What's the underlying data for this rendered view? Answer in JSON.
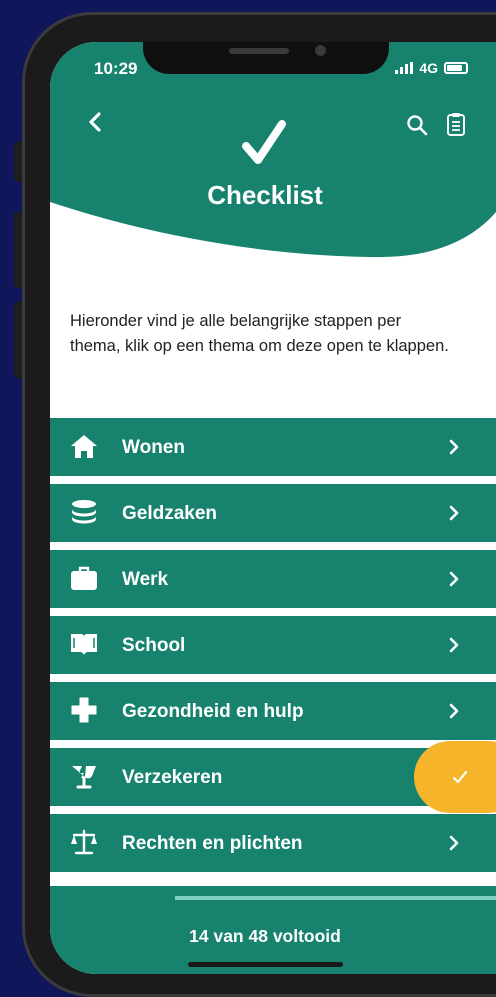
{
  "status_bar": {
    "time": "10:29",
    "network": "4G"
  },
  "header": {
    "title": "Checklist"
  },
  "intro": "Hieronder vind je alle belangrijke stappen per thema, klik op een thema om deze open te klappen.",
  "themes": [
    {
      "label": "Wonen",
      "icon": "house-icon",
      "completed": false
    },
    {
      "label": "Geldzaken",
      "icon": "coins-icon",
      "completed": false
    },
    {
      "label": "Werk",
      "icon": "briefcase-icon",
      "completed": false
    },
    {
      "label": "School",
      "icon": "book-icon",
      "completed": false
    },
    {
      "label": "Gezondheid en hulp",
      "icon": "medical-cross-icon",
      "completed": false
    },
    {
      "label": "Verzekeren",
      "icon": "umbrella-icon",
      "completed": true
    },
    {
      "label": "Rechten en plichten",
      "icon": "scales-icon",
      "completed": false
    }
  ],
  "progress": {
    "text": "14 van 48 voltooid",
    "completed": 14,
    "total": 48
  },
  "colors": {
    "primary": "#17836f",
    "accent": "#f5b42a",
    "background": "#10165a",
    "progress": "#7fd0c1"
  }
}
